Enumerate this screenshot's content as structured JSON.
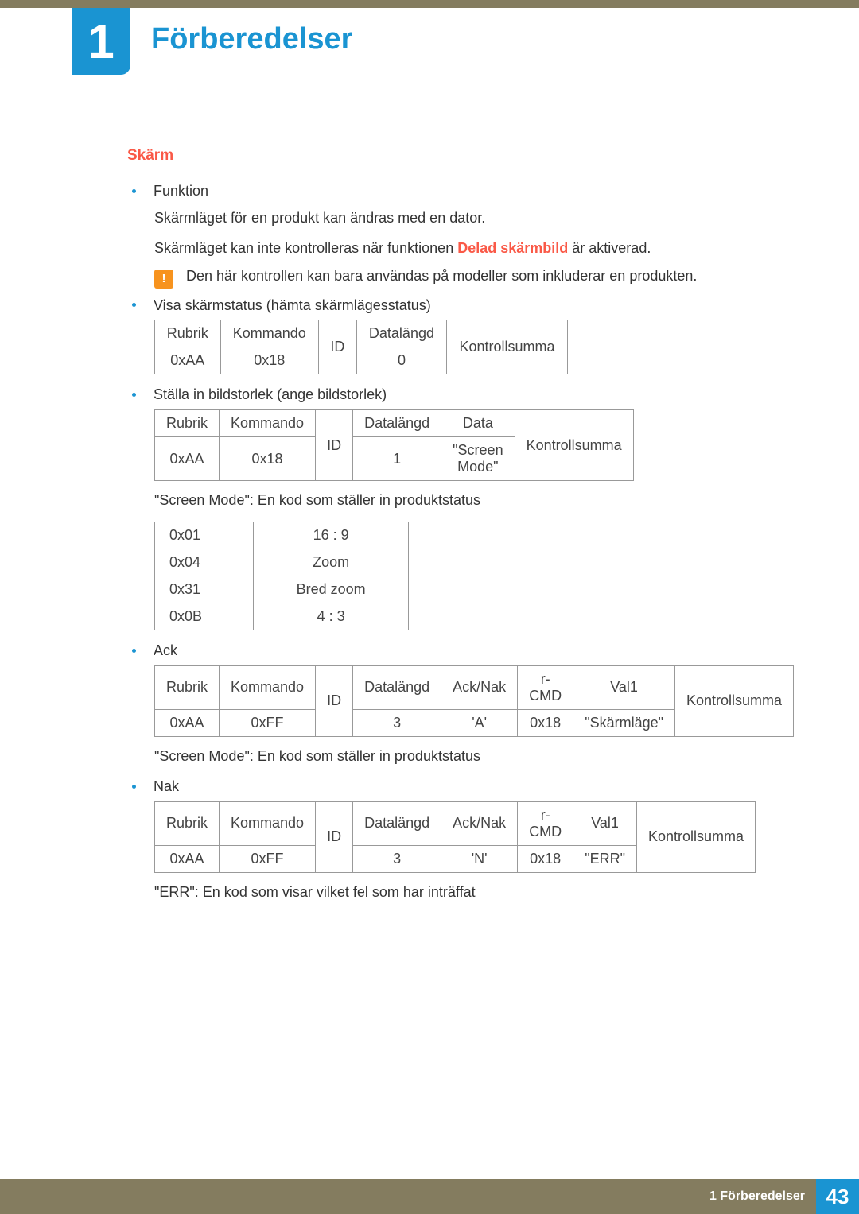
{
  "chapter_number": "1",
  "chapter_title": "Förberedelser",
  "section_title": "Skärm",
  "b1": {
    "head": "Funktion",
    "p1": "Skärmläget för en produkt kan ändras med en dator.",
    "p2a": "Skärmläget kan inte kontrolleras när funktionen ",
    "p2bold": "Delad skärmbild",
    "p2c": " är aktiverad.",
    "note": "Den här kontrollen kan bara användas på modeller som inkluderar en produkten."
  },
  "t1": {
    "title": "Visa skärmstatus (hämta skärmlägesstatus)",
    "h": [
      "Rubrik",
      "Kommando",
      "ID",
      "Datalängd",
      "Kontrollsumma"
    ],
    "r": [
      "0xAA",
      "0x18",
      "",
      "0",
      ""
    ]
  },
  "t2": {
    "title": "Ställa in bildstorlek (ange bildstorlek)",
    "h": [
      "Rubrik",
      "Kommando",
      "ID",
      "Datalängd",
      "Data",
      "Kontrollsumma"
    ],
    "r": [
      "0xAA",
      "0x18",
      "",
      "1",
      "\"Screen Mode\"",
      ""
    ]
  },
  "caption_t2": "\"Screen Mode\": En kod som ställer in produktstatus",
  "t3": {
    "rows": [
      [
        "0x01",
        "16 : 9"
      ],
      [
        "0x04",
        "Zoom"
      ],
      [
        "0x31",
        "Bred zoom"
      ],
      [
        "0x0B",
        "4 : 3"
      ]
    ]
  },
  "t4": {
    "title": "Ack",
    "h": [
      "Rubrik",
      "Kommando",
      "ID",
      "Datalängd",
      "Ack/Nak",
      "r-CMD",
      "Val1",
      "Kontrollsumma"
    ],
    "r": [
      "0xAA",
      "0xFF",
      "",
      "3",
      "'A'",
      "0x18",
      "\"Skärmläge\"",
      ""
    ]
  },
  "caption_t4": "\"Screen Mode\": En kod som ställer in produktstatus",
  "t5": {
    "title": "Nak",
    "h": [
      "Rubrik",
      "Kommando",
      "ID",
      "Datalängd",
      "Ack/Nak",
      "r-CMD",
      "Val1",
      "Kontrollsumma"
    ],
    "r": [
      "0xAA",
      "0xFF",
      "",
      "3",
      "'N'",
      "0x18",
      "\"ERR\"",
      ""
    ]
  },
  "caption_t5": "\"ERR\": En kod som visar vilket fel som har inträffat",
  "footer_text": "1 Förberedelser",
  "page_number": "43"
}
